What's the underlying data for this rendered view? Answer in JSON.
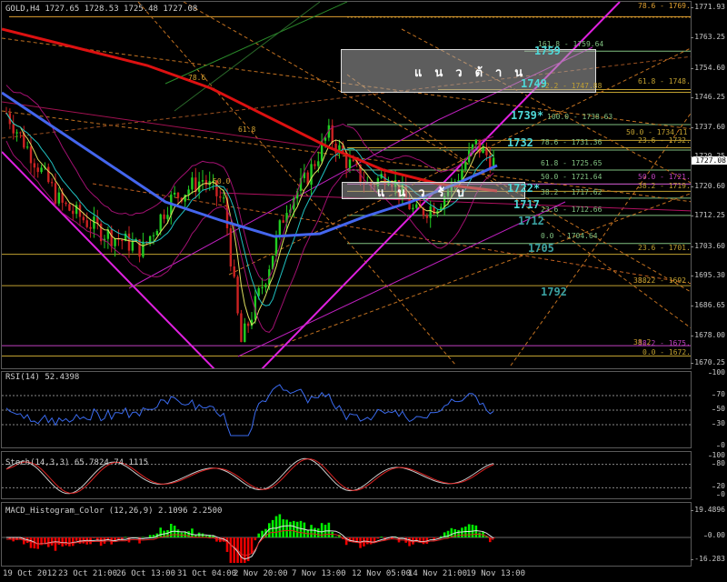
{
  "main": {
    "header": "GOLD,H4  1727.65 1728.53 1725.48 1727.08",
    "current_price": "1727.08",
    "price_ticks": [
      "1771.93",
      "1763.25",
      "1754.60",
      "1746.25",
      "1737.60",
      "1729.25",
      "1720.60",
      "1712.25",
      "1703.60",
      "1695.30",
      "1686.65",
      "1678.00",
      "1670.25"
    ],
    "zones": {
      "resistance_label": "แนวต้าน",
      "support_label": "แนวรับ"
    },
    "levels": [
      {
        "text": "78.6 - 1769.37",
        "color": "#e0a030"
      },
      {
        "text": "161.8 - 1759.64",
        "color": "#80c080"
      },
      {
        "text": "61.8 - 1748.66",
        "color": "#c0a030"
      },
      {
        "text": "100.0 - 1738.63",
        "color": "#80c080"
      },
      {
        "text": "50.0 - 1734.11",
        "color": "#c0a030"
      },
      {
        "text": "78.6 - 1731.36",
        "color": "#80c080"
      },
      {
        "text": "23.6 - 1732.01",
        "color": "#c0a030"
      },
      {
        "text": "61.8 - 1725.65",
        "color": "#80c080"
      },
      {
        "text": "50.0 - 1721.64",
        "color": "#80c080"
      },
      {
        "text": "50.0 - 1721.65",
        "color": "#c040c0"
      },
      {
        "text": "38.2 - 1717.62",
        "color": "#80c080"
      },
      {
        "text": "38.2 - 1719.56",
        "color": "#c0a030"
      },
      {
        "text": "23.6 - 1712.66",
        "color": "#80c080"
      },
      {
        "text": "0.0 - 1704.64",
        "color": "#80c080"
      },
      {
        "text": "23.6 - 1701.56",
        "color": "#c0a030"
      },
      {
        "text": "38.2 - 1692.58",
        "color": "#c0a030"
      },
      {
        "text": "38.2 - 1675.43",
        "color": "#c040c0"
      },
      {
        "text": "0.0 - 1672.47",
        "color": "#c0a030"
      },
      {
        "text": "72.2 - 1747.88",
        "color": "#c0a030"
      }
    ],
    "annotations": [
      {
        "text": "1759",
        "color": "#4fd8d8"
      },
      {
        "text": "1749",
        "color": "#4fd8d8"
      },
      {
        "text": "1739*",
        "color": "#4fd8d8"
      },
      {
        "text": "1732",
        "color": "#4fd8d8"
      },
      {
        "text": "1722*",
        "color": "#4fd8d8"
      },
      {
        "text": "1717",
        "color": "#4fd8d8"
      },
      {
        "text": "1712",
        "color": "#3aa0a0"
      },
      {
        "text": "1705",
        "color": "#3aa0a0"
      },
      {
        "text": "1792",
        "color": "#3aa0a0"
      }
    ],
    "fib_small": [
      "78.6",
      "61.8",
      "50.0",
      "38.2",
      "38.2"
    ]
  },
  "rsi": {
    "title": "RSI(14) 52.4398",
    "ticks": [
      "100",
      "70",
      "50",
      "30",
      "0"
    ]
  },
  "stoch": {
    "title": "Stoch(14,3,3) 65.7824 74.1115",
    "ticks": [
      "100",
      "80",
      "20",
      "0"
    ]
  },
  "macd": {
    "title": "MACD_Histogram_Color (12,26,9)  2.1096  2.2500",
    "ticks": [
      "19.4896",
      "0.00",
      "-16.283"
    ]
  },
  "time_axis": [
    "19 Oct 2012",
    "23 Oct 21:00",
    "26 Oct 13:00",
    "31 Oct 04:00",
    "2 Nov 20:00",
    "7 Nov 13:00",
    "12 Nov 05:00",
    "14 Nov 21:00",
    "19 Nov 13:00"
  ],
  "colors": {
    "bull": "#22cc22",
    "bear": "#cc2222",
    "ma_red": "#dd1111",
    "ma_blue": "#4466ee",
    "trend": "#e020e0",
    "macd_pos": "#00ee00",
    "macd_neg": "#ee0000"
  }
}
